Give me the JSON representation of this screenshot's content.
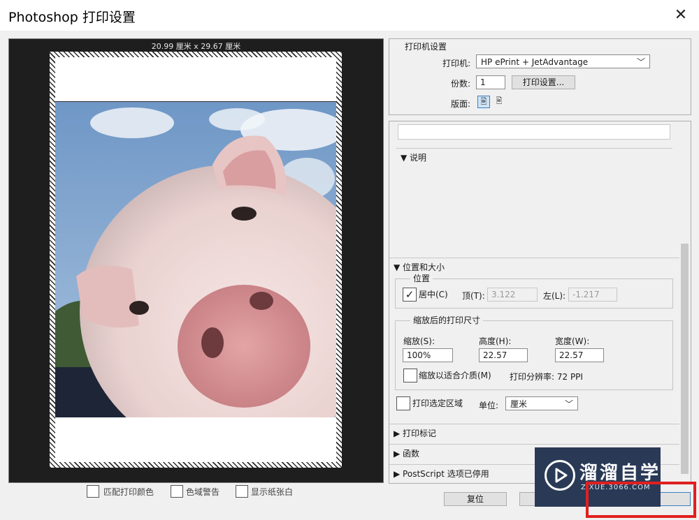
{
  "window": {
    "title": "Photoshop 打印设置",
    "close_icon": "close-icon"
  },
  "preview": {
    "dimensions": "20.99 厘米 x 29.67 厘米"
  },
  "printer_settings": {
    "section_title": "打印机设置",
    "printer_label": "打印机:",
    "printer_value": "HP ePrint + JetAdvantage",
    "copies_label": "份数:",
    "copies_value": "1",
    "print_settings_button": "打印设置...",
    "layout_label": "版面:"
  },
  "description": {
    "header": "▼  说明"
  },
  "position_size": {
    "header": "▼  位置和大小",
    "position_legend": "位置",
    "center_label": "居中(C)",
    "center_checked": true,
    "top_label": "顶(T):",
    "top_value": "3.122",
    "left_label": "左(L):",
    "left_value": "-1.217",
    "scaled_legend": "缩放后的打印尺寸",
    "scale_label": "缩放(S):",
    "scale_value": "100%",
    "height_label": "高度(H):",
    "height_value": "22.57",
    "width_label": "宽度(W):",
    "width_value": "22.57",
    "fit_media_label": "缩放以适合介质(M)",
    "resolution_text": "打印分辨率: 72 PPI",
    "print_selection_label": "打印选定区域",
    "unit_label": "单位:",
    "unit_value": "厘米"
  },
  "collapsed_sections": {
    "print_marks": "▶  打印标记",
    "functions": "▶  函数",
    "postscript": "▶  PostScript 选项已停用"
  },
  "bottom_options": {
    "match_colors": "匹配打印颜色",
    "gamut_warning": "色域警告",
    "show_paper_white": "显示纸张白"
  },
  "buttons": {
    "reset": "复位"
  },
  "watermark": {
    "title": "溜溜自学",
    "subtitle": "ZIXUE.3066.COM"
  },
  "colors": {
    "watermark_bg": "#2a3a56",
    "highlight_red": "#e02020",
    "preview_bg": "#1e1e1e"
  }
}
